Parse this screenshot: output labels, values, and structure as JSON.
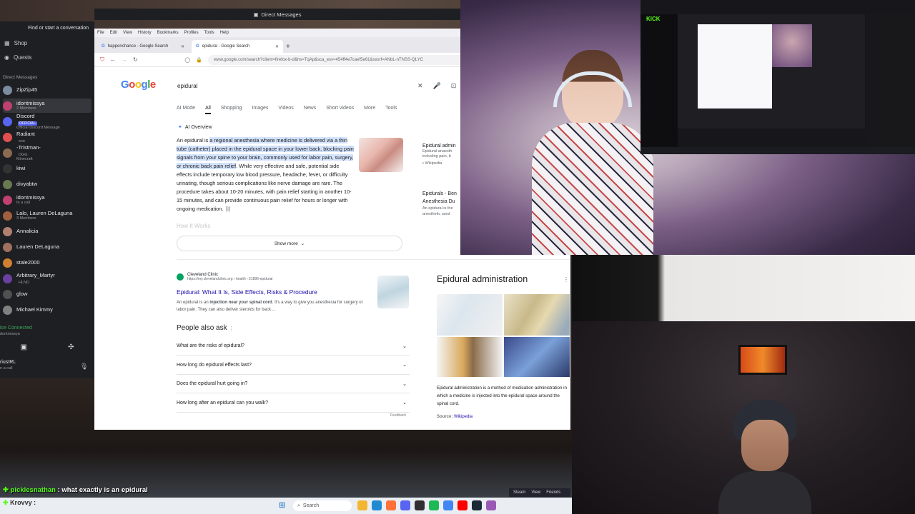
{
  "discord": {
    "search": "Find or start a conversation",
    "nav": [
      {
        "label": "Shop",
        "icon": "shop-icon"
      },
      {
        "label": "Quests",
        "icon": "quests-icon"
      }
    ],
    "section": "Direct Messages",
    "items": [
      {
        "name": "ZipZip45",
        "sub": "",
        "color": "#7b8ca0"
      },
      {
        "name": "idontmissya",
        "sub": "2 Members",
        "color": "#c04070",
        "active": true
      },
      {
        "name": "Discord",
        "badge": "OFFICIAL",
        "sub": "Official Discord Message",
        "color": "#5865f2"
      },
      {
        "name": "Radiant",
        "sub": "",
        "tag": "soo",
        "color": "#e05050"
      },
      {
        "name": "-Tristman-",
        "sub": "Minecraft",
        "tag": "DGG",
        "color": "#8a6a50"
      },
      {
        "name": "kiwi",
        "sub": "",
        "color": "#333"
      },
      {
        "name": "divyabtw",
        "sub": "",
        "color": "#6a7a50"
      },
      {
        "name": "idontmissya",
        "sub": "In a call",
        "color": "#c04070"
      },
      {
        "name": "Lalo, Lauren DeLaguna",
        "sub": "3 Members",
        "color": "#a06040"
      },
      {
        "name": "Annalicia",
        "sub": "",
        "color": "#b08070"
      },
      {
        "name": "Lauren DeLaguna",
        "sub": "",
        "color": "#a07060"
      },
      {
        "name": "stale2000",
        "sub": "",
        "color": "#d08030"
      },
      {
        "name": "Arbitrary_Martyr",
        "tag": "HLND",
        "sub": "",
        "color": "#6a40a0"
      },
      {
        "name": "glow",
        "sub": "",
        "color": "#505050"
      },
      {
        "name": "Michael Kimmy",
        "sub": "",
        "color": "#808080"
      }
    ],
    "voice": "ice Connected",
    "voice_sub": "dontmissya",
    "user": "riusIRL",
    "user_sub": "n a call"
  },
  "dm_bar": "Direct Messages",
  "browser": {
    "menu": [
      "File",
      "Edit",
      "View",
      "History",
      "Bookmarks",
      "Profiles",
      "Tools",
      "Help"
    ],
    "tabs": [
      {
        "title": "happenchance - Google Search"
      },
      {
        "title": "epidural - Google Search",
        "active": true
      }
    ],
    "url": "www.google.com/search?client=firefox-b-d&hs=TqAp&sca_esv=454ff4e7caef5e61&sxsrf=ANbL-nTNSS-QLYC",
    "query": "epidural",
    "filters": [
      "AI Mode",
      "All",
      "Shopping",
      "Images",
      "Videos",
      "News",
      "Short videos",
      "More",
      "Tools"
    ],
    "active_filter": "All",
    "ai_overview": {
      "label": "AI Overview",
      "lead": "An epidural is ",
      "highlight": "a regional anesthesia where medicine is delivered via a thin tube (catheter) placed in the epidural space in your lower back, blocking pain signals from your spine to your brain, commonly used for labor pain, surgery, or chronic back pain relief",
      "rest": ". While very effective and safe, potential side effects include temporary low blood pressure, headache, fever, or difficulty urinating, though serious complications like nerve damage are rare. The procedure takes about 10-20 minutes, with pain relief starting in another 10-15 minutes, and can provide continuous pain relief for hours or longer with ongoing medication.",
      "faded": "How It Works",
      "show_more": "Show more",
      "side1_title": "Epidural admin",
      "side1_text": "Epidural anaesth including pain, b",
      "side1_src": "Wikipedia",
      "side2_title": "Epidurals - Ben Anesthesia Du",
      "side2_text": "An epidural is the anesthetic used"
    },
    "result": {
      "site": "Cleveland Clinic",
      "url": "https://my.clevelandclinic.org › health › 21896-epidural",
      "title": "Epidural: What It Is, Side Effects, Risks & Procedure",
      "snippet_pre": "An epidural is an ",
      "snippet_bold": "injection near your spinal cord",
      "snippet_post": ". It's a way to give you anesthesia for surgery or labor pain. They can also deliver steroids for back ..."
    },
    "paa": {
      "title": "People also ask",
      "questions": [
        "What are the risks of epidural?",
        "How long do epidural effects last?",
        "Does the epidural hurt going in?",
        "How long after an epidural can you walk?"
      ],
      "feedback": "Feedback"
    },
    "knowledge_panel": {
      "title": "Epidural administration",
      "description": "Epidural administration is a method of medication administration in which a medicine is injected into the epidural space around the spinal cord.",
      "source_label": "Source:",
      "source": "Wikipedia"
    }
  },
  "monitor": {
    "brand": "KICK"
  },
  "chat": {
    "line1_user": "picklesnathan",
    "line1_msg": " : what exactly is an epidural",
    "line2_user": "Krovvy :"
  },
  "taskbar": {
    "search": "Search",
    "steam": [
      "Steam",
      "View",
      "Friends"
    ]
  },
  "colors": {
    "kick_green": "#53fc18",
    "google_link": "#1a0dab",
    "discord_bg": "#1e1f22"
  }
}
